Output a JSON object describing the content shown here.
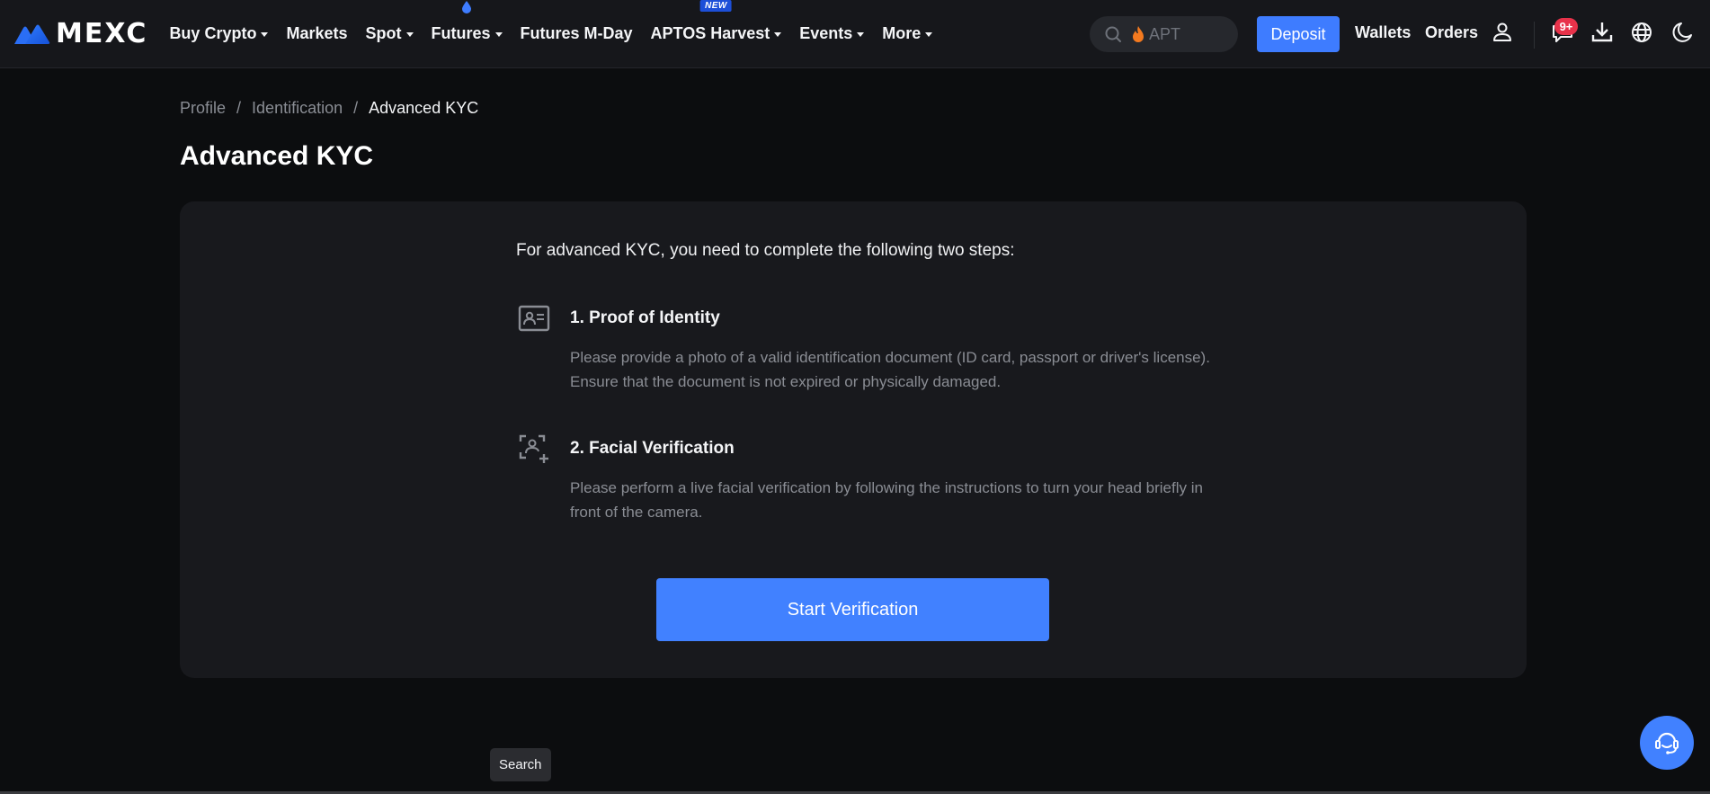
{
  "brand": {
    "name": "MEXC",
    "accent": "#3e7cff"
  },
  "nav": {
    "items": [
      {
        "label": "Buy Crypto",
        "has_dropdown": true
      },
      {
        "label": "Markets",
        "has_dropdown": false
      },
      {
        "label": "Spot",
        "has_dropdown": true
      },
      {
        "label": "Futures",
        "has_dropdown": true,
        "icon": "droplet-icon"
      },
      {
        "label": "Futures M-Day",
        "has_dropdown": false
      },
      {
        "label": "APTOS Harvest",
        "has_dropdown": true,
        "badge": "NEW"
      },
      {
        "label": "Events",
        "has_dropdown": true
      },
      {
        "label": "More",
        "has_dropdown": true
      }
    ]
  },
  "header": {
    "search_placeholder": "APT",
    "deposit_label": "Deposit",
    "wallets_label": "Wallets",
    "orders_label": "Orders",
    "notification_count": "9+",
    "icons": [
      "user-icon",
      "message-icon",
      "download-icon",
      "globe-icon",
      "moon-icon"
    ]
  },
  "breadcrumb": {
    "items": [
      "Profile",
      "Identification",
      "Advanced KYC"
    ],
    "separator": "/"
  },
  "page": {
    "title": "Advanced KYC",
    "intro": "For advanced KYC, you need to complete the following two steps:",
    "steps": [
      {
        "title": "1. Proof of Identity",
        "icon": "id-card-icon",
        "description": "Please provide a photo of a valid identification document (ID card, passport or driver's license). Ensure that the document is not expired or physically damaged."
      },
      {
        "title": "2. Facial Verification",
        "icon": "face-scan-icon",
        "description": "Please perform a live facial verification by following the instructions to turn your head briefly in front of the camera."
      }
    ],
    "start_button": "Start Verification"
  },
  "tooltip": {
    "text": "Search"
  },
  "support": {
    "icon": "headset-icon"
  }
}
